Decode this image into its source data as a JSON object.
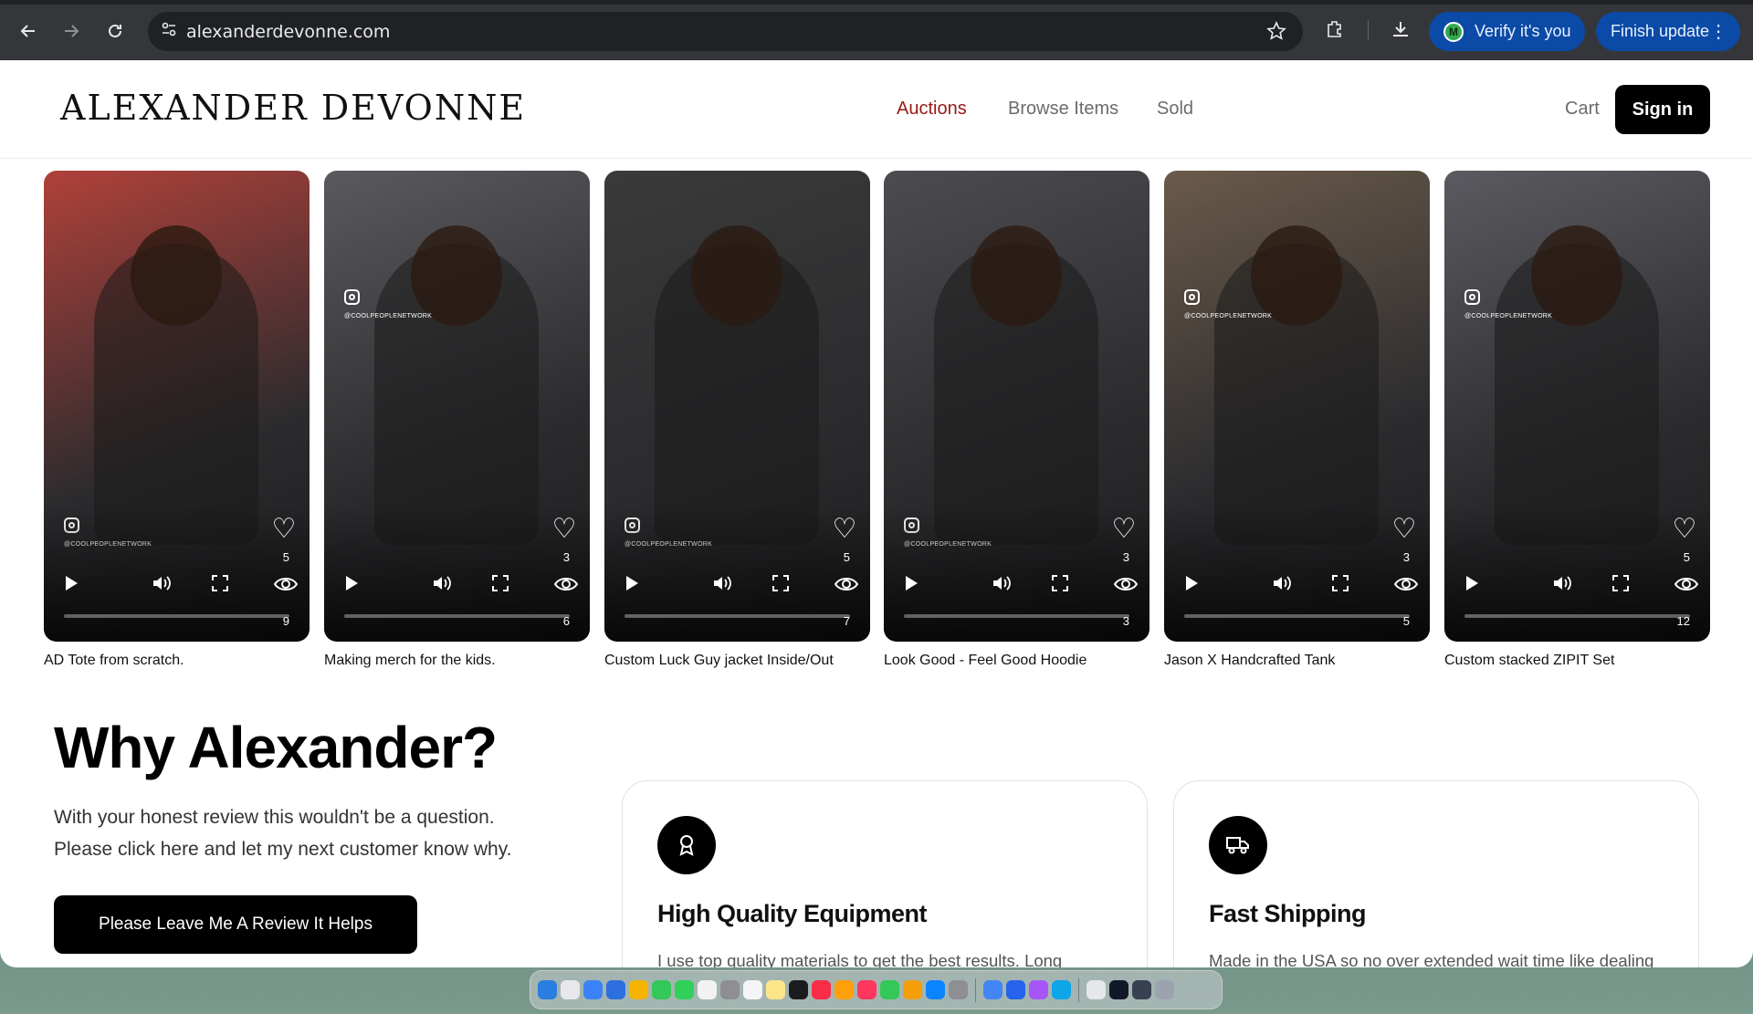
{
  "browser": {
    "url": "alexanderdevonne.com",
    "verify_label": "Verify it's you",
    "profile_initial": "M",
    "update_label": "Finish update"
  },
  "site": {
    "brand": "ALEXANDER DEVONNE",
    "nav": [
      "Auctions",
      "Browse Items",
      "Sold"
    ],
    "active_nav": "Auctions",
    "cart_label": "Cart",
    "signin_label": "Sign in",
    "accent_color": "#9a1717"
  },
  "videos": [
    {
      "caption": "AD Tote from scratch.",
      "likes": "5",
      "views": "9",
      "handle": "@COOLPEOPLENETWORK",
      "tone": "#b0413a"
    },
    {
      "caption": "Making merch for the kids.",
      "likes": "3",
      "views": "6",
      "handle": "@COOLPEOPLENETWORK",
      "tone": "#5a5a5e"
    },
    {
      "caption": "Custom Luck Guy jacket Inside/Out",
      "likes": "5",
      "views": "7",
      "handle": "@COOLPEOPLENETWORK",
      "tone": "#3a3a3a"
    },
    {
      "caption": "Look Good - Feel Good Hoodie",
      "likes": "3",
      "views": "3",
      "handle": "@COOLPEOPLENETWORK",
      "tone": "#4c4c50"
    },
    {
      "caption": "Jason X Handcrafted Tank",
      "likes": "3",
      "views": "5",
      "handle": "@COOLPEOPLENETWORK",
      "tone": "#6a5a4a"
    },
    {
      "caption": "Custom stacked ZIPIT Set",
      "likes": "5",
      "views": "12",
      "handle": "@COOLPEOPLENETWORK",
      "tone": "#5a5a60"
    }
  ],
  "why": {
    "heading": "Why Alexander?",
    "line1": "With your honest review this wouldn't be a question.",
    "line2": "Please click here and let my next customer know why.",
    "button": "Please Leave Me A Review It Helps"
  },
  "features": [
    {
      "icon": "award-icon",
      "title": "High Quality Equipment",
      "desc": "I use top quality materials to get the best results. Long lasting DTF prints & High Quality embroidery."
    },
    {
      "icon": "truck-icon",
      "title": "Fast Shipping",
      "desc": "Made in the USA so no over extended wait time like dealing with over seas vendors. Any concern check our FAQ's"
    }
  ]
}
